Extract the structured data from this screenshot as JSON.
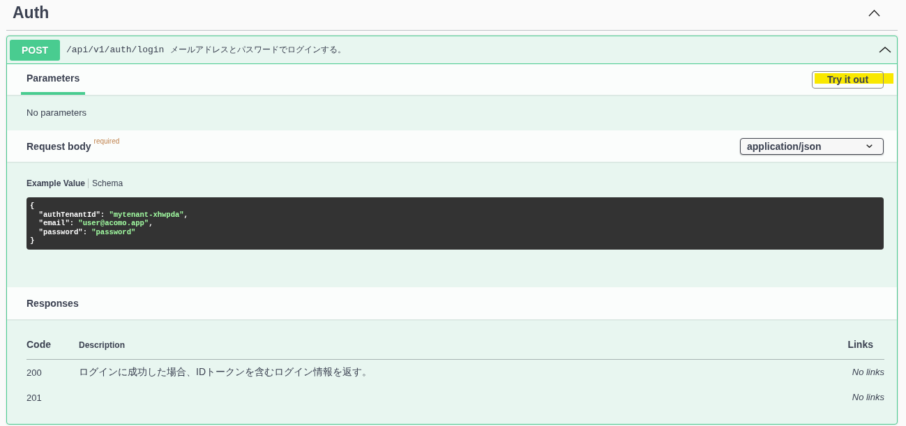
{
  "tag": {
    "title": "Auth",
    "expanded": true
  },
  "operation": {
    "method": "POST",
    "path": "/api/v1/auth/login",
    "summary": "メールアドレスとパスワードでログインする。",
    "expanded": true
  },
  "parameters": {
    "tabs": [
      {
        "label": "Parameters",
        "selected": true
      }
    ],
    "try_it_out": {
      "label": "Try it out",
      "highlighted": true
    },
    "message": "No parameters"
  },
  "request_body": {
    "title": "Request body",
    "required_label": "required",
    "content_type": "application/json",
    "tabs": [
      {
        "label": "Example Value",
        "selected": true
      },
      {
        "label": "Schema",
        "selected": false
      }
    ],
    "example": [
      [
        {
          "kind": "punct",
          "text": "{"
        }
      ],
      [
        {
          "kind": "key",
          "text": "  \"authTenantId\""
        },
        {
          "kind": "punct",
          "text": ": "
        },
        {
          "kind": "string",
          "text": "\"mytenant-xhwpda\""
        },
        {
          "kind": "punct",
          "text": ","
        }
      ],
      [
        {
          "kind": "key",
          "text": "  \"email\""
        },
        {
          "kind": "punct",
          "text": ": "
        },
        {
          "kind": "string",
          "text": "\"user@acomo.app\""
        },
        {
          "kind": "punct",
          "text": ","
        }
      ],
      [
        {
          "kind": "key",
          "text": "  \"password\""
        },
        {
          "kind": "punct",
          "text": ": "
        },
        {
          "kind": "string",
          "text": "\"password\""
        }
      ],
      [
        {
          "kind": "punct",
          "text": "}"
        }
      ]
    ]
  },
  "responses": {
    "title": "Responses",
    "columns": [
      "Code",
      "Description",
      "Links"
    ],
    "rows": [
      {
        "code": "200",
        "description": "ログインに成功した場合、IDトークンを含むログイン情報を返す。",
        "links": "No links"
      },
      {
        "code": "201",
        "links": "No links"
      }
    ]
  }
}
